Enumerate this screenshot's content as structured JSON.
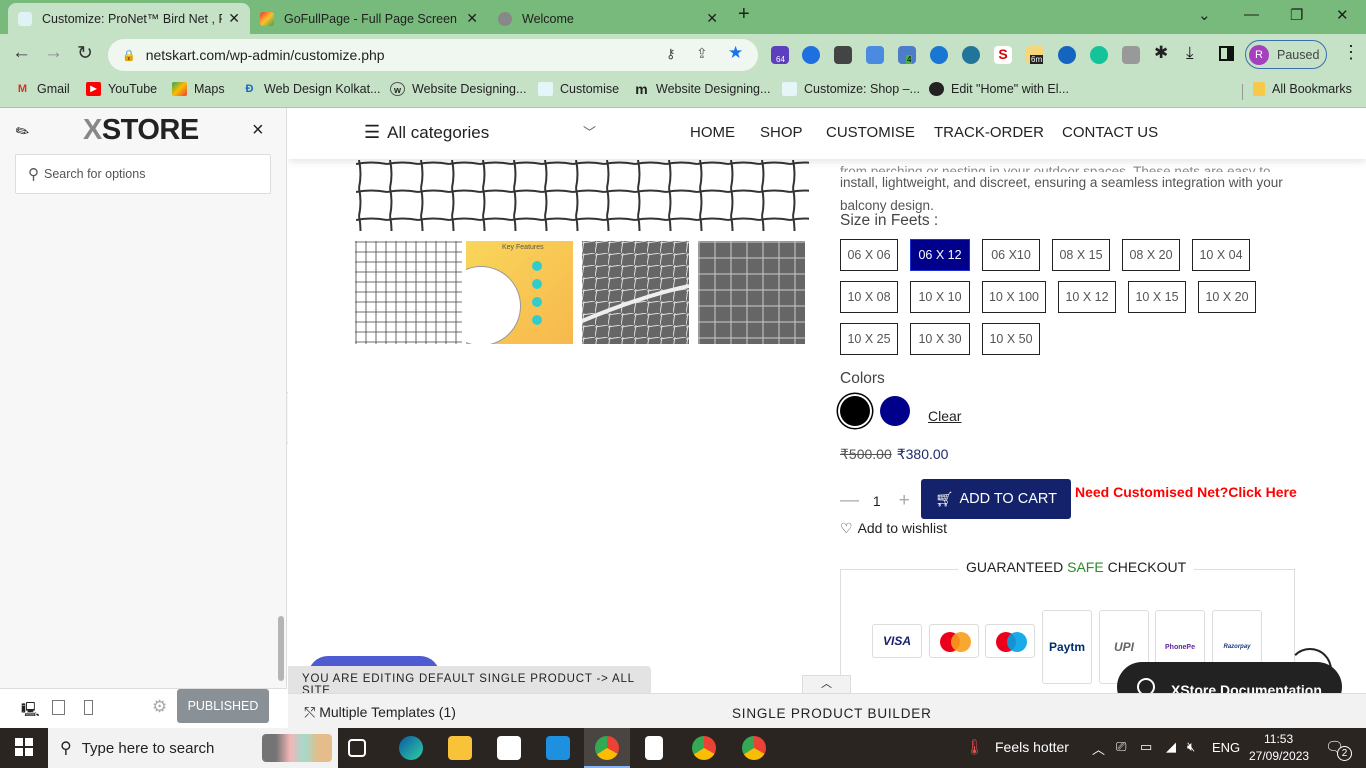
{
  "browser": {
    "tabs": [
      {
        "title": "Customize: ProNet™ Bird Net , Pi",
        "active": true
      },
      {
        "title": "GoFullPage - Full Page Screen Ca",
        "active": false
      },
      {
        "title": "Welcome",
        "active": false
      }
    ],
    "new_tab": "+",
    "url": "netskart.com/wp-admin/customize.php",
    "extension_badges": {
      "ext1": "64",
      "ext5": "4",
      "ext9": "6m"
    },
    "profile": {
      "initial": "R",
      "label": "Paused"
    },
    "bookmarks": [
      {
        "label": "Gmail",
        "icon": "gmail-icon"
      },
      {
        "label": "YouTube",
        "icon": "youtube-icon"
      },
      {
        "label": "Maps",
        "icon": "maps-icon"
      },
      {
        "label": "Web Design Kolkat...",
        "icon": "d-icon"
      },
      {
        "label": "Website Designing...",
        "icon": "w-icon"
      },
      {
        "label": "Customise",
        "icon": "pronet-icon"
      },
      {
        "label": "Website Designing...",
        "icon": "m-icon"
      },
      {
        "label": "Customize: Shop –...",
        "icon": "pronet-icon"
      },
      {
        "label": "Edit \"Home\" with El...",
        "icon": "globe-icon"
      }
    ],
    "all_bookmarks": "All Bookmarks"
  },
  "customizer": {
    "logo_x": "X",
    "logo_text": "STORE",
    "close": "×",
    "search_placeholder": "Search for options",
    "publish_label": "PUBLISHED",
    "collapse_icon": "‹"
  },
  "site": {
    "all_categories": "All categories",
    "nav": [
      "HOME",
      "SHOP",
      "CUSTOMISE",
      "TRACK-ORDER",
      "CONTACT US"
    ],
    "description_cut": "from perching or nesting in your outdoor spaces. These nets are easy to",
    "description_1": "install, lightweight, and discreet, ensuring a seamless integration with your",
    "description_2": "balcony design.",
    "thumb_key_features": "Key Features",
    "size_label": "Size in Feets :",
    "sizes": [
      {
        "label": "06 X 06",
        "selected": false
      },
      {
        "label": "06 X 12",
        "selected": true
      },
      {
        "label": "06 X10",
        "selected": false
      },
      {
        "label": "08 X 15",
        "selected": false
      },
      {
        "label": "08 X 20",
        "selected": false
      },
      {
        "label": "10 X 04",
        "selected": false
      },
      {
        "label": "10 X 08",
        "selected": false
      },
      {
        "label": "10 X 10",
        "selected": false
      },
      {
        "label": "10 X 100",
        "selected": false
      },
      {
        "label": "10 X 12",
        "selected": false
      },
      {
        "label": "10 X 15",
        "selected": false
      },
      {
        "label": "10 X 20",
        "selected": false
      },
      {
        "label": "10 X 25",
        "selected": false
      },
      {
        "label": "10 X 30",
        "selected": false
      },
      {
        "label": "10 X 50",
        "selected": false
      }
    ],
    "colors_label": "Colors",
    "colors": [
      {
        "name": "black",
        "hex": "#000000",
        "selected": true
      },
      {
        "name": "blue",
        "hex": "#00008b",
        "selected": false
      }
    ],
    "clear_label": "Clear",
    "price_old": "₹500.00",
    "price_new": "₹380.00",
    "quantity": "1",
    "qty_minus": "—",
    "qty_plus": "+",
    "add_to_cart": "ADD TO CART",
    "custom_link": "Need Customised Net?Click Here",
    "wishlist": "Add to wishlist",
    "checkout_pre": "GUARANTEED ",
    "checkout_safe": "SAFE",
    "checkout_post": " CHECKOUT",
    "payments": [
      "VISA",
      "Mastercard",
      "Maestro",
      "Paytm",
      "UPI",
      "PhonePe",
      "Razorpay"
    ],
    "doc_label": "XStore Documentation",
    "editing_banner": "YOU ARE EDITING DEFAULT SINGLE PRODUCT -> ALL SITE"
  },
  "builder": {
    "multiple_templates": "Multiple Templates (1)",
    "title": "SINGLE PRODUCT BUILDER"
  },
  "taskbar": {
    "search_placeholder": "Type here to search",
    "weather": "Feels hotter",
    "lang": "ENG",
    "time": "11:53",
    "date": "27/09/2023",
    "notifications": "2"
  }
}
